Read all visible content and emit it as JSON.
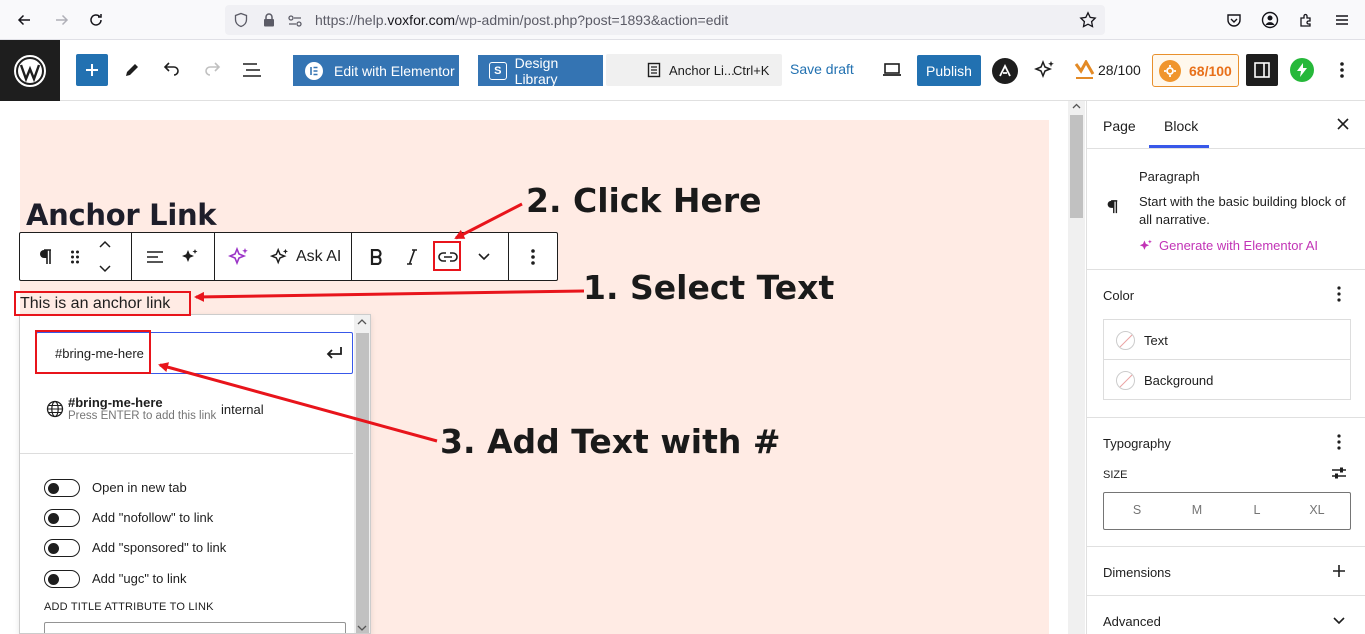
{
  "browser": {
    "url_prefix": "https://help.",
    "url_domain": "voxfor.com",
    "url_path": "/wp-admin/post.php?post=1893&action=edit"
  },
  "toolbar": {
    "elementor_label": "Edit with Elementor",
    "design_library_label": "Design Library",
    "command_title": "Anchor Li...",
    "command_shortcut": "Ctrl+K",
    "save_draft_label": "Save draft",
    "publish_label": "Publish",
    "score_1": "28/100",
    "score_2": "68/100"
  },
  "editor": {
    "heading": "Anchor Link",
    "paragraph": "This is an anchor link",
    "ask_ai_label": "Ask AI"
  },
  "link_popover": {
    "input_value": "#bring-me-here",
    "suggestion_title": "#bring-me-here",
    "suggestion_subtitle": "Press ENTER to add this link",
    "suggestion_type": "internal",
    "options": [
      {
        "label": "Open in new tab"
      },
      {
        "label": "Add \"nofollow\" to link"
      },
      {
        "label": "Add \"sponsored\" to link"
      },
      {
        "label": "Add \"ugc\" to link"
      }
    ],
    "title_attr_label": "ADD TITLE ATTRIBUTE TO LINK"
  },
  "annotations": {
    "step1": "1. Select Text",
    "step2": "2. Click Here",
    "step3": "3. Add Text with #"
  },
  "sidebar": {
    "tab_page": "Page",
    "tab_block": "Block",
    "block_name": "Paragraph",
    "block_desc": "Start with the basic building block of all narrative.",
    "generate_ai": "Generate with Elementor AI",
    "color_section": "Color",
    "color_text": "Text",
    "color_background": "Background",
    "typography_section": "Typography",
    "size_label": "SIZE",
    "sizes": [
      "S",
      "M",
      "L",
      "XL"
    ],
    "dimensions_section": "Dimensions",
    "advanced_section": "Advanced"
  },
  "colors": {
    "accent": "#3858e9",
    "wp_blue": "#2271b1",
    "annotation_red": "#e8141b",
    "canvas_bg": "#ffebe4",
    "elementor_ai": "#c233b6"
  }
}
